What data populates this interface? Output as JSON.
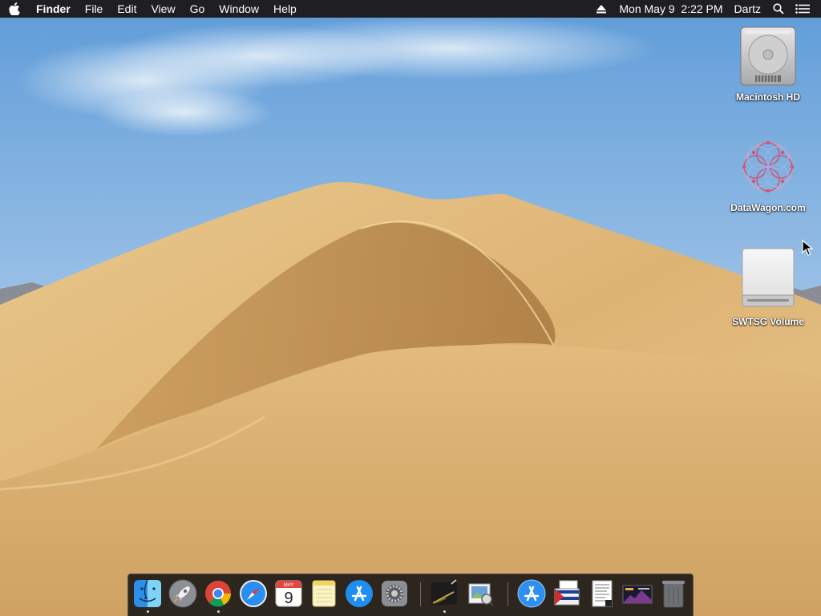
{
  "menubar": {
    "app_name": "Finder",
    "menus": [
      "File",
      "Edit",
      "View",
      "Go",
      "Window",
      "Help"
    ],
    "clock": "Mon May 9  2:22 PM",
    "user": "Dartz",
    "icons": [
      "apple-logo-icon",
      "eject-icon",
      "spotlight-search-icon",
      "notification-center-icon"
    ]
  },
  "desktop": {
    "icons": [
      {
        "label": "Macintosh HD",
        "icon": "hard-drive-icon"
      },
      {
        "label": "DataWagon.com",
        "icon": "network-volume-icon"
      },
      {
        "label": "SWTSG Volume",
        "icon": "external-drive-icon"
      }
    ]
  },
  "dock": {
    "calendar": {
      "month": "MAY",
      "day": "9"
    },
    "apps": [
      {
        "name": "finder",
        "running": true
      },
      {
        "name": "launchpad",
        "running": false
      },
      {
        "name": "chrome",
        "running": true
      },
      {
        "name": "safari",
        "running": false
      },
      {
        "name": "calendar",
        "running": false
      },
      {
        "name": "notes",
        "running": false
      },
      {
        "name": "app-store",
        "running": false
      },
      {
        "name": "system-preferences",
        "running": false
      },
      {
        "name": "terminal-script",
        "running": true
      },
      {
        "name": "preview",
        "running": false
      },
      {
        "name": "applications-folder",
        "running": false
      },
      {
        "name": "document-stack",
        "running": false
      },
      {
        "name": "downloads-stack",
        "running": false
      },
      {
        "name": "screenshot-stack",
        "running": false
      },
      {
        "name": "trash",
        "running": false
      }
    ]
  },
  "colors": {
    "menubar": "#1f1f22",
    "sky_top": "#6fa7dd",
    "sky_bottom": "#b9d3ea",
    "sand_light": "#e8c48a",
    "sand_dark": "#b8874a"
  }
}
